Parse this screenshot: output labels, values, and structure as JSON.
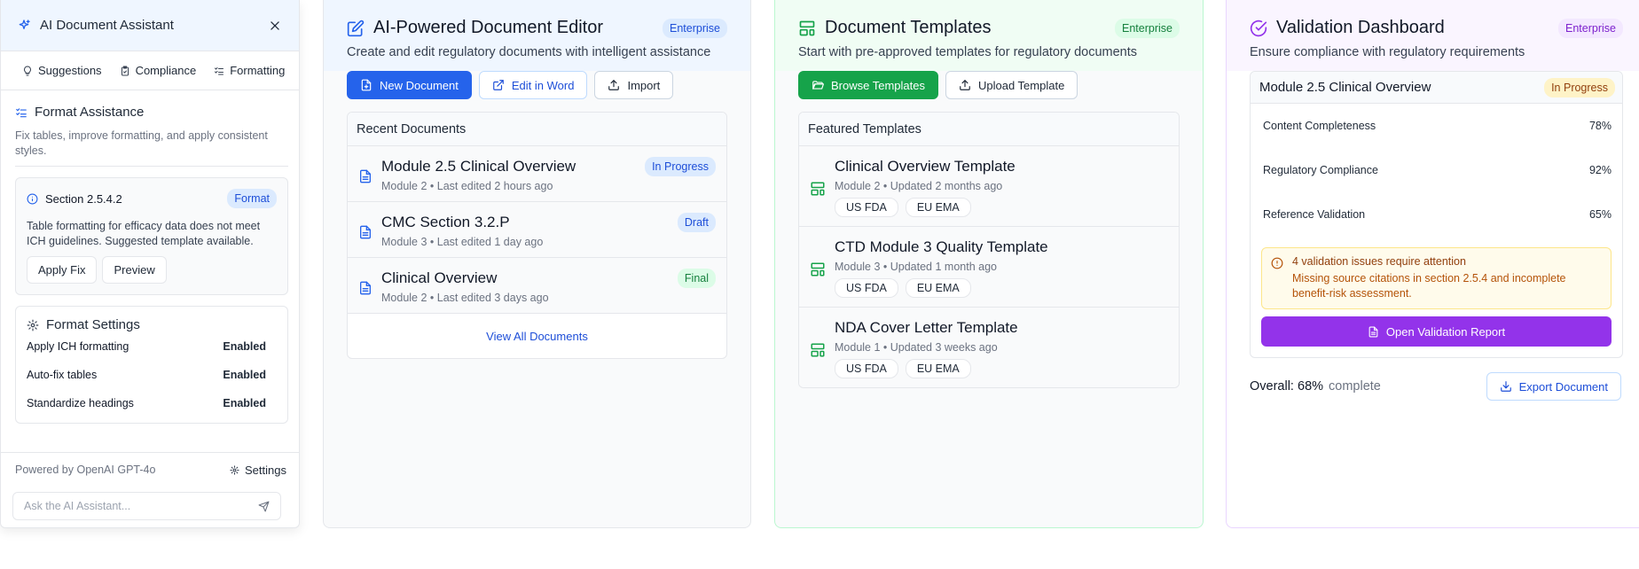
{
  "assistant": {
    "title": "AI Document Assistant",
    "tabs": [
      {
        "label": "Suggestions",
        "icon": "lightbulb-icon"
      },
      {
        "label": "Compliance",
        "icon": "clipboard-check-icon"
      },
      {
        "label": "Formatting",
        "icon": "list-check-icon"
      }
    ],
    "format_assistance": {
      "title": "Format Assistance",
      "description": "Fix tables, improve formatting, and apply consistent styles."
    },
    "section_card": {
      "title": "Section 2.5.4.2",
      "badge": "Format",
      "text": "Table formatting for efficacy data does not meet ICH guidelines. Suggested template available.",
      "apply_label": "Apply Fix",
      "preview_label": "Preview"
    },
    "format_settings": {
      "title": "Format Settings",
      "rows": [
        {
          "label": "Apply ICH formatting",
          "value": "Enabled"
        },
        {
          "label": "Auto-fix tables",
          "value": "Enabled"
        },
        {
          "label": "Standardize headings",
          "value": "Enabled"
        }
      ]
    },
    "powered_by": "Powered by OpenAI GPT-4o",
    "settings_label": "Settings",
    "ask_placeholder": "Ask the AI Assistant..."
  },
  "editor": {
    "title": "AI-Powered Document Editor",
    "badge": "Enterprise",
    "subtitle": "Create and edit regulatory documents with intelligent assistance",
    "buttons": {
      "new": "New Document",
      "word": "Edit in Word",
      "import": "Import"
    },
    "recent_title": "Recent Documents",
    "documents": [
      {
        "name": "Module 2.5 Clinical Overview",
        "meta": "Module 2 • Last edited 2 hours ago",
        "status": "In Progress"
      },
      {
        "name": "CMC Section 3.2.P",
        "meta": "Module 3 • Last edited 1 day ago",
        "status": "Draft"
      },
      {
        "name": "Clinical Overview",
        "meta": "Module 2 • Last edited 3 days ago",
        "status": "Final"
      }
    ],
    "view_all": "View All Documents"
  },
  "templates": {
    "title": "Document Templates",
    "badge": "Enterprise",
    "subtitle": "Start with pre-approved templates for regulatory documents",
    "buttons": {
      "browse": "Browse Templates",
      "upload": "Upload Template"
    },
    "featured_title": "Featured Templates",
    "items": [
      {
        "name": "Clinical Overview Template",
        "meta": "Module 2 • Updated 2 months ago",
        "tags": [
          "US FDA",
          "EU EMA"
        ]
      },
      {
        "name": "CTD Module 3 Quality Template",
        "meta": "Module 3 • Updated 1 month ago",
        "tags": [
          "US FDA",
          "EU EMA"
        ]
      },
      {
        "name": "NDA Cover Letter Template",
        "meta": "Module 1 • Updated 3 weeks ago",
        "tags": [
          "US FDA",
          "EU EMA"
        ]
      }
    ]
  },
  "validation": {
    "title": "Validation Dashboard",
    "badge": "Enterprise",
    "subtitle": "Ensure compliance with regulatory requirements",
    "doc_name": "Module 2.5 Clinical Overview",
    "doc_status": "In Progress",
    "metrics": [
      {
        "label": "Content Completeness",
        "value": "78%"
      },
      {
        "label": "Regulatory Compliance",
        "value": "92%"
      },
      {
        "label": "Reference Validation",
        "value": "65%"
      }
    ],
    "alert_title": "4 validation issues require attention",
    "alert_text": "Missing source citations in section 2.5.4 and incomplete benefit-risk assessment.",
    "open_report": "Open Validation Report",
    "overall_label": "Overall:",
    "overall_value": "68%",
    "overall_suffix": "complete",
    "export_label": "Export Document"
  },
  "colors": {
    "blue": "#2563eb",
    "green": "#16a34a",
    "purple": "#9333ea",
    "editor_bg": "#eff6ff",
    "templates_bg": "#f0fdf4",
    "validation_bg": "#faf5ff"
  }
}
